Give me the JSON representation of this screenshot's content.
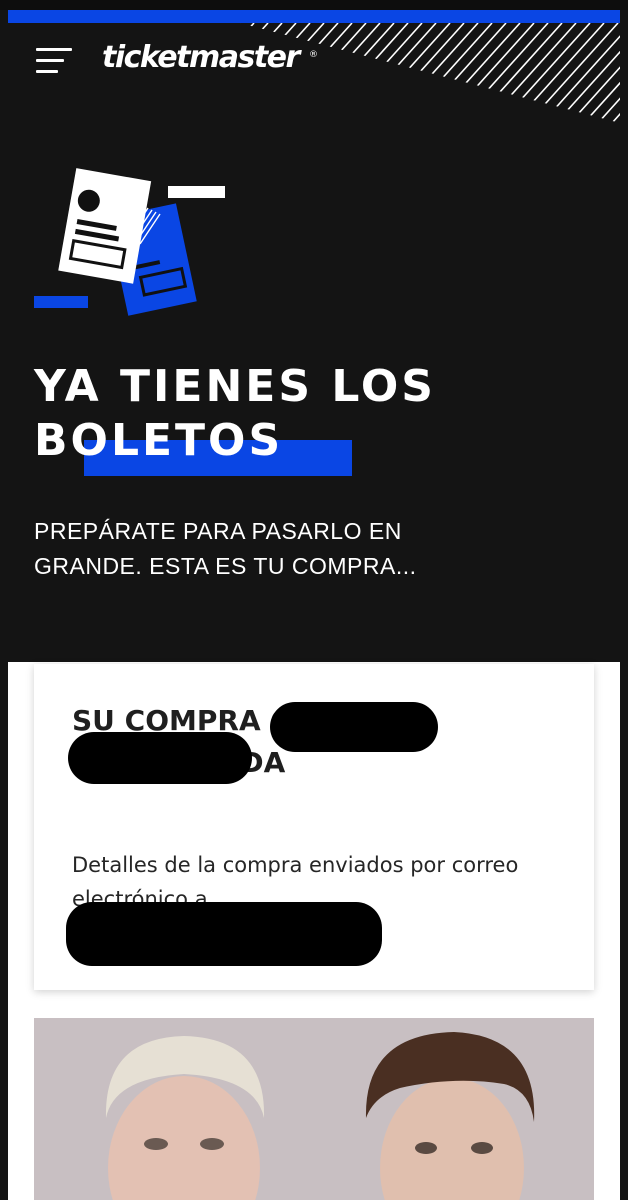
{
  "header": {
    "brand": "ticketmaster",
    "registered_mark": "®",
    "menu_icon": "hamburger-menu-icon",
    "accent_color": "#0a46e4",
    "background_color": "#141414"
  },
  "hero": {
    "illustration_icon": "tickets-illustration-icon",
    "title": "YA TIENES LOS BOLETOS",
    "subtitle": "PREPÁRATE PARA PASARLO EN GRANDE. ESTA ES TU COMPRA..."
  },
  "confirmation": {
    "title": "SU COMPRA C ESTA CONFIRMADA",
    "details": "Detalles de la compra enviados por correo electrónico a"
  },
  "event_image": {
    "description_icon": "artist-photo"
  }
}
